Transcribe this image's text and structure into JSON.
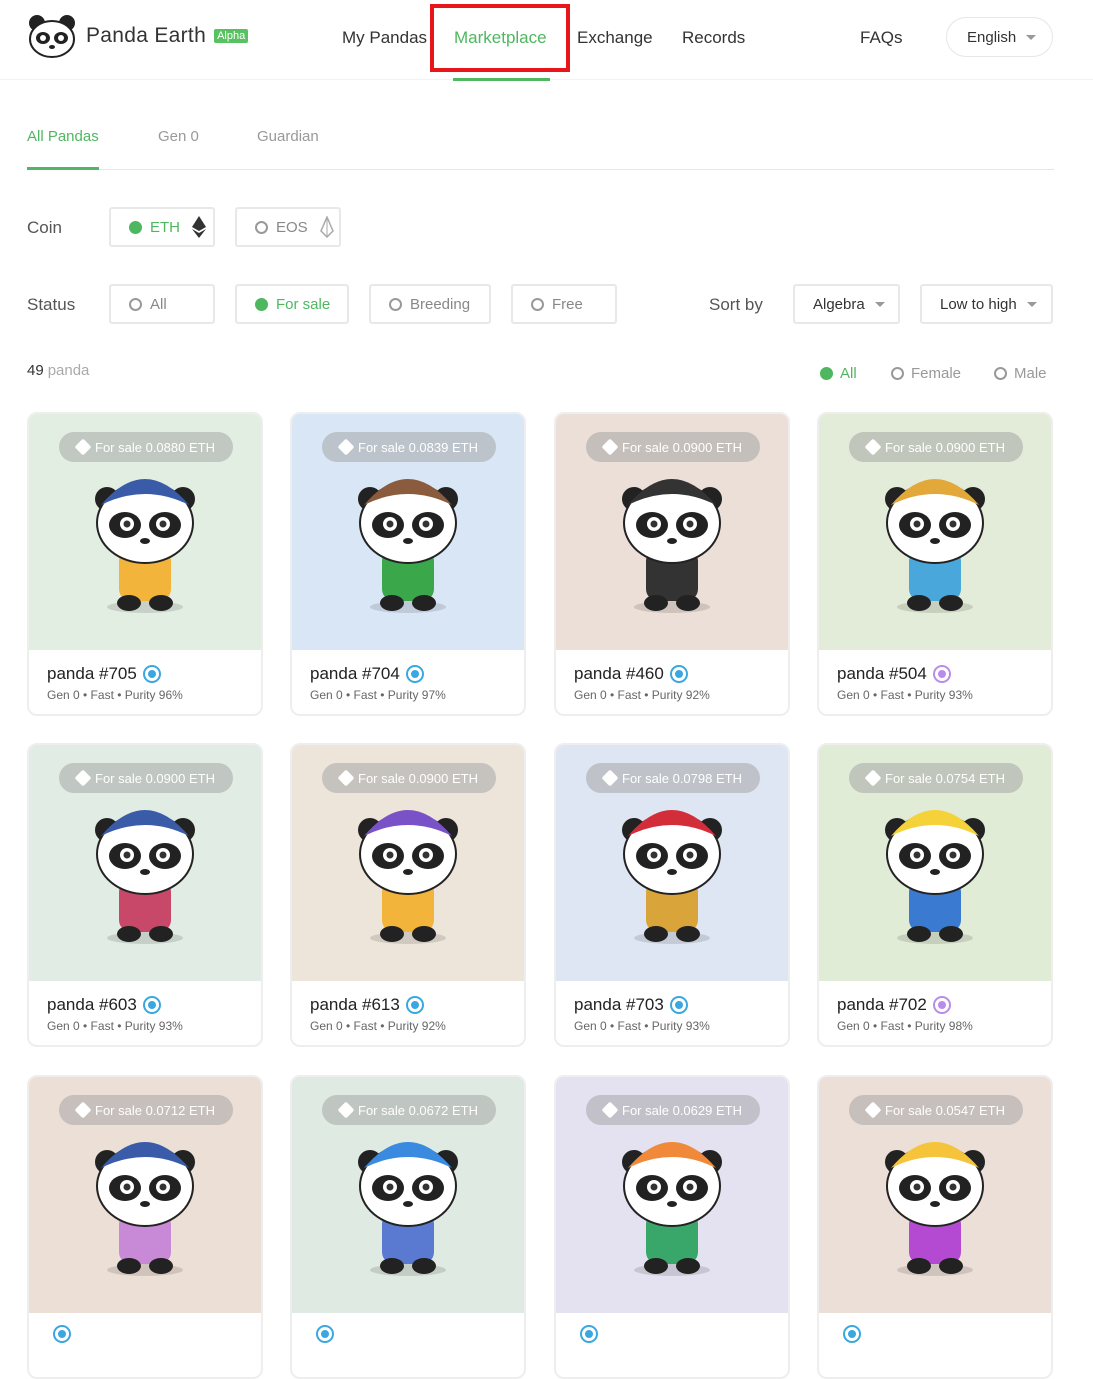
{
  "header": {
    "brand": "Panda Earth",
    "badge": "Alpha",
    "nav": [
      "My Pandas",
      "Marketplace",
      "Exchange",
      "Records"
    ],
    "faq": "FAQs",
    "language": "English"
  },
  "tabs": [
    "All Pandas",
    "Gen 0",
    "Guardian"
  ],
  "coin": {
    "label": "Coin",
    "options": [
      "ETH",
      "EOS"
    ]
  },
  "status": {
    "label": "Status",
    "options": [
      "All",
      "For sale",
      "Breeding",
      "Free"
    ]
  },
  "sort": {
    "label": "Sort by",
    "field": "Algebra",
    "order": "Low to high"
  },
  "count": {
    "value": "49",
    "unit": "panda"
  },
  "gender": [
    "All",
    "Female",
    "Male"
  ],
  "cards": [
    {
      "price": "For sale 0.0880 ETH",
      "name": "panda #705",
      "meta": "Gen 0 • Fast • Purity 96%",
      "bg": "#e3eee3",
      "badge": "#3aa7e0",
      "hat": "#3a5ca8",
      "fur": "#ffffff",
      "outfit": "#f2b43a"
    },
    {
      "price": "For sale 0.0839 ETH",
      "name": "panda #704",
      "meta": "Gen 0 • Fast • Purity 97%",
      "bg": "#d9e6f5",
      "badge": "#3aa7e0",
      "hat": "#8a5b3c",
      "fur": "#ffffff",
      "outfit": "#3aa74a"
    },
    {
      "price": "For sale 0.0900 ETH",
      "name": "panda #460",
      "meta": "Gen 0 • Fast • Purity 92%",
      "bg": "#ebdfd7",
      "badge": "#3aa7e0",
      "hat": "#333333",
      "fur": "#ffffff",
      "outfit": "#333333"
    },
    {
      "price": "For sale 0.0900 ETH",
      "name": "panda #504",
      "meta": "Gen 0 • Fast • Purity 93%",
      "bg": "#e3ecd8",
      "badge": "#b98ce8",
      "hat": "#e2a93a",
      "fur": "#ffffff",
      "outfit": "#4aa7dc"
    },
    {
      "price": "For sale 0.0900 ETH",
      "name": "panda #603",
      "meta": "Gen 0 • Fast • Purity 93%",
      "bg": "#e1ece4",
      "badge": "#3aa7e0",
      "hat": "#3a5ca8",
      "fur": "#ffffff",
      "outfit": "#c8486a"
    },
    {
      "price": "For sale 0.0900 ETH",
      "name": "panda #613",
      "meta": "Gen 0 • Fast • Purity 92%",
      "bg": "#ede5da",
      "badge": "#3aa7e0",
      "hat": "#7a52c7",
      "fur": "#ffffff",
      "outfit": "#f2b43a"
    },
    {
      "price": "For sale 0.0798 ETH",
      "name": "panda #703",
      "meta": "Gen 0 • Fast • Purity 93%",
      "bg": "#dfe6f3",
      "badge": "#3aa7e0",
      "hat": "#d32d3a",
      "fur": "#ffffff",
      "outfit": "#d9a53a"
    },
    {
      "price": "For sale 0.0754 ETH",
      "name": "panda #702",
      "meta": "Gen 0 • Fast • Purity 98%",
      "bg": "#e1ecd6",
      "badge": "#b98ce8",
      "hat": "#f5d23a",
      "fur": "#ffffff",
      "outfit": "#3a7ad1"
    },
    {
      "price": "For sale 0.0712 ETH",
      "name": "",
      "meta": "",
      "bg": "#ecdfd6",
      "badge": "#3aa7e0",
      "hat": "#3a5ca8",
      "fur": "#ffffff",
      "outfit": "#c88ad6"
    },
    {
      "price": "For sale 0.0672 ETH",
      "name": "",
      "meta": "",
      "bg": "#dfeae2",
      "badge": "#3aa7e0",
      "hat": "#3a8ae0",
      "fur": "#ffffff",
      "outfit": "#5a7ad1"
    },
    {
      "price": "For sale 0.0629 ETH",
      "name": "",
      "meta": "",
      "bg": "#e4e1f0",
      "badge": "#3aa7e0",
      "hat": "#f08a3a",
      "fur": "#ffffff",
      "outfit": "#3aa76a"
    },
    {
      "price": "For sale 0.0547 ETH",
      "name": "",
      "meta": "",
      "bg": "#ecdfd8",
      "badge": "#3aa7e0",
      "hat": "#f5c43a",
      "fur": "#ffffff",
      "outfit": "#b44ad1"
    }
  ]
}
